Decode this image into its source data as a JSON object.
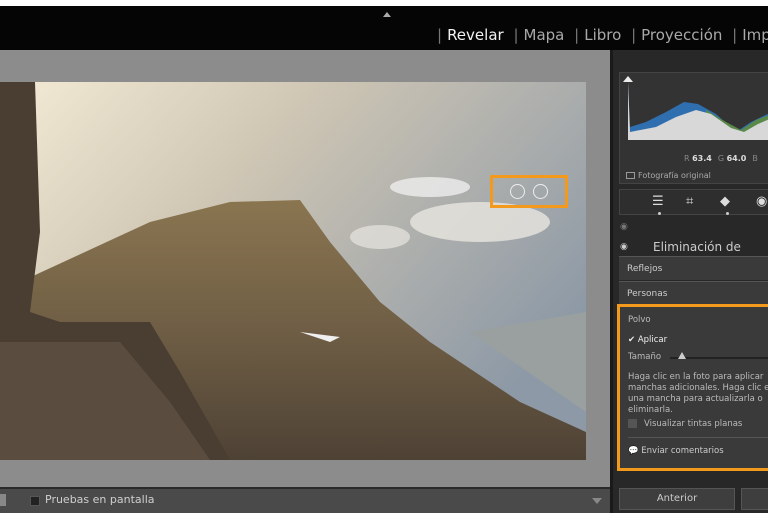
{
  "header": {
    "modules": [
      "Revelar",
      "Mapa",
      "Libro",
      "Proyección",
      "Imprimir"
    ],
    "active": "Revelar"
  },
  "histogram": {
    "r_label": "R",
    "r": "63.4",
    "g_label": "G",
    "g": "64.0",
    "b_label": "B",
    "original_photo": "Fotografía original"
  },
  "tools": [
    "sliders-icon",
    "crop-icon",
    "eraser-icon",
    "red-eye-icon"
  ],
  "panel": {
    "title": "Eliminación de",
    "sections": [
      "Reflejos",
      "Personas"
    ],
    "dust": {
      "title": "Polvo",
      "apply": "Aplicar",
      "apply_checked": true,
      "size_label": "Tamaño",
      "size_value": 0.1,
      "help": "Haga clic en la foto para aplicar manchas adicionales. Haga clic en una mancha para actualizarla o eliminarla.",
      "visualize": "Visualizar tintas planas",
      "visualize_checked": false,
      "feedback": "Enviar comentarios"
    }
  },
  "footer": {
    "previous": "Anterior"
  },
  "toolbar": {
    "soft_proofing": "Pruebas en pantalla"
  },
  "colors": {
    "highlight": "#f39a1c"
  }
}
